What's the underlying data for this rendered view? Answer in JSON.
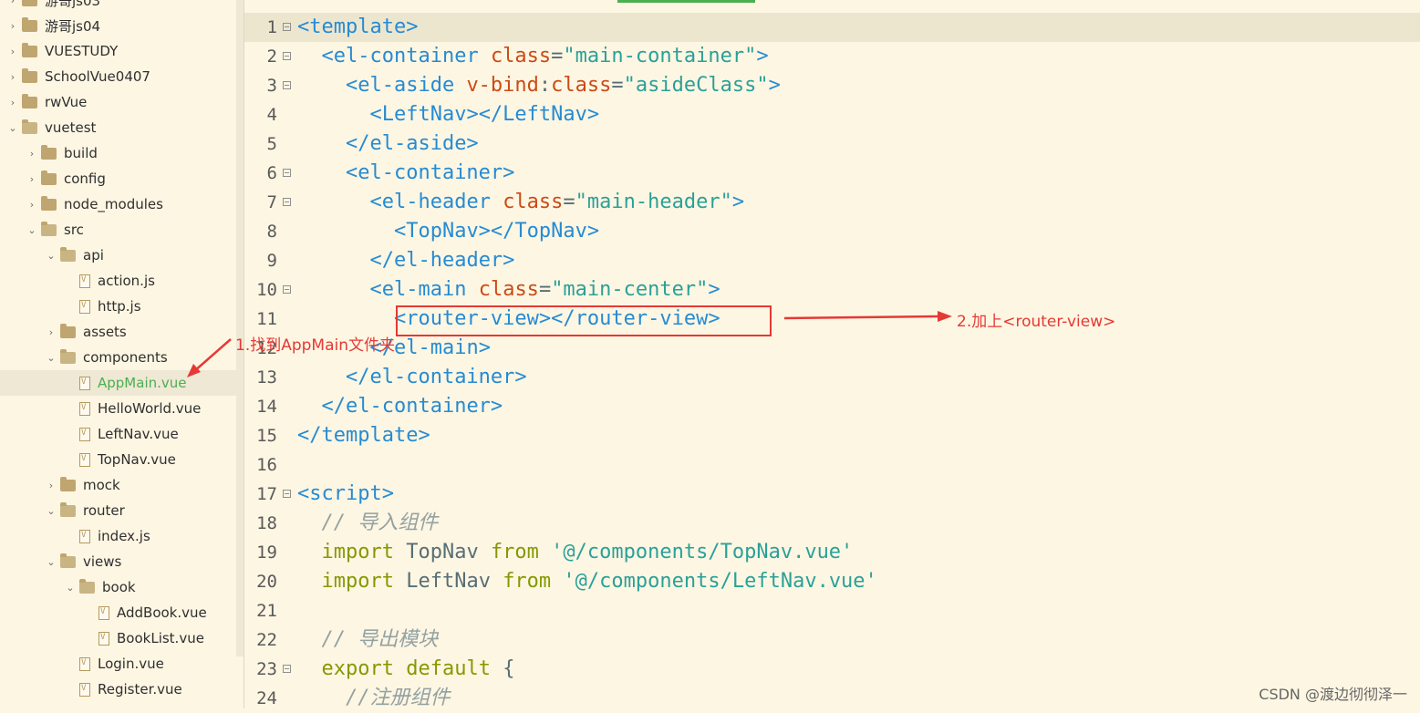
{
  "sidebar": {
    "items": [
      {
        "label": "游哥js03",
        "type": "folder",
        "depth": 0,
        "expanded": false
      },
      {
        "label": "游哥js04",
        "type": "folder",
        "depth": 0,
        "expanded": false
      },
      {
        "label": "VUESTUDY",
        "type": "folder",
        "depth": 0,
        "expanded": false
      },
      {
        "label": "SchoolVue0407",
        "type": "folder",
        "depth": 0,
        "expanded": false
      },
      {
        "label": "rwVue",
        "type": "folder",
        "depth": 0,
        "expanded": false
      },
      {
        "label": "vuetest",
        "type": "folder",
        "depth": 0,
        "expanded": true
      },
      {
        "label": "build",
        "type": "folder",
        "depth": 1,
        "expanded": false
      },
      {
        "label": "config",
        "type": "folder",
        "depth": 1,
        "expanded": false
      },
      {
        "label": "node_modules",
        "type": "folder",
        "depth": 1,
        "expanded": false
      },
      {
        "label": "src",
        "type": "folder",
        "depth": 1,
        "expanded": true
      },
      {
        "label": "api",
        "type": "folder",
        "depth": 2,
        "expanded": true
      },
      {
        "label": "action.js",
        "type": "file",
        "depth": 3
      },
      {
        "label": "http.js",
        "type": "file",
        "depth": 3
      },
      {
        "label": "assets",
        "type": "folder",
        "depth": 2,
        "expanded": false
      },
      {
        "label": "components",
        "type": "folder",
        "depth": 2,
        "expanded": true
      },
      {
        "label": "AppMain.vue",
        "type": "file",
        "depth": 3,
        "selected": true
      },
      {
        "label": "HelloWorld.vue",
        "type": "file",
        "depth": 3
      },
      {
        "label": "LeftNav.vue",
        "type": "file",
        "depth": 3
      },
      {
        "label": "TopNav.vue",
        "type": "file",
        "depth": 3
      },
      {
        "label": "mock",
        "type": "folder",
        "depth": 2,
        "expanded": false
      },
      {
        "label": "router",
        "type": "folder",
        "depth": 2,
        "expanded": true
      },
      {
        "label": "index.js",
        "type": "file",
        "depth": 3
      },
      {
        "label": "views",
        "type": "folder",
        "depth": 2,
        "expanded": true
      },
      {
        "label": "book",
        "type": "folder",
        "depth": 3,
        "expanded": true
      },
      {
        "label": "AddBook.vue",
        "type": "file",
        "depth": 4
      },
      {
        "label": "BookList.vue",
        "type": "file",
        "depth": 4
      },
      {
        "label": "Login.vue",
        "type": "file",
        "depth": 3
      },
      {
        "label": "Register.vue",
        "type": "file",
        "depth": 3
      }
    ]
  },
  "editor": {
    "current_line": 1,
    "lines": [
      {
        "n": "1",
        "fold": true,
        "tokens": [
          [
            "tag",
            "<template>"
          ]
        ]
      },
      {
        "n": "2",
        "fold": true,
        "tokens": [
          [
            "pun",
            "  "
          ],
          [
            "tag",
            "<el-container "
          ],
          [
            "attr",
            "class"
          ],
          [
            "pun",
            "="
          ],
          [
            "str",
            "\"main-container\""
          ],
          [
            "tag",
            ">"
          ]
        ]
      },
      {
        "n": "3",
        "fold": true,
        "tokens": [
          [
            "pun",
            "    "
          ],
          [
            "tag",
            "<el-aside "
          ],
          [
            "attr",
            "v-bind"
          ],
          [
            "pun",
            ":"
          ],
          [
            "attr",
            "class"
          ],
          [
            "pun",
            "="
          ],
          [
            "str",
            "\"asideClass\""
          ],
          [
            "tag",
            ">"
          ]
        ]
      },
      {
        "n": "4",
        "fold": false,
        "tokens": [
          [
            "pun",
            "      "
          ],
          [
            "tag",
            "<LeftNav></LeftNav>"
          ]
        ]
      },
      {
        "n": "5",
        "fold": false,
        "tokens": [
          [
            "pun",
            "    "
          ],
          [
            "tag",
            "</el-aside>"
          ]
        ]
      },
      {
        "n": "6",
        "fold": true,
        "tokens": [
          [
            "pun",
            "    "
          ],
          [
            "tag",
            "<el-container>"
          ]
        ]
      },
      {
        "n": "7",
        "fold": true,
        "tokens": [
          [
            "pun",
            "      "
          ],
          [
            "tag",
            "<el-header "
          ],
          [
            "attr",
            "class"
          ],
          [
            "pun",
            "="
          ],
          [
            "str",
            "\"main-header\""
          ],
          [
            "tag",
            ">"
          ]
        ]
      },
      {
        "n": "8",
        "fold": false,
        "tokens": [
          [
            "pun",
            "        "
          ],
          [
            "tag",
            "<TopNav></TopNav>"
          ]
        ]
      },
      {
        "n": "9",
        "fold": false,
        "tokens": [
          [
            "pun",
            "      "
          ],
          [
            "tag",
            "</el-header>"
          ]
        ]
      },
      {
        "n": "10",
        "fold": true,
        "tokens": [
          [
            "pun",
            "      "
          ],
          [
            "tag",
            "<el-main "
          ],
          [
            "attr",
            "class"
          ],
          [
            "pun",
            "="
          ],
          [
            "str",
            "\"main-center\""
          ],
          [
            "tag",
            ">"
          ]
        ]
      },
      {
        "n": "11",
        "fold": false,
        "tokens": [
          [
            "pun",
            "        "
          ],
          [
            "tag",
            "<router-view></router-view>"
          ]
        ]
      },
      {
        "n": "12",
        "fold": false,
        "tokens": [
          [
            "pun",
            "      "
          ],
          [
            "tag",
            "</el-main>"
          ]
        ]
      },
      {
        "n": "13",
        "fold": false,
        "tokens": [
          [
            "pun",
            "    "
          ],
          [
            "tag",
            "</el-container>"
          ]
        ]
      },
      {
        "n": "14",
        "fold": false,
        "tokens": [
          [
            "pun",
            "  "
          ],
          [
            "tag",
            "</el-container>"
          ]
        ]
      },
      {
        "n": "15",
        "fold": false,
        "tokens": [
          [
            "tag",
            "</template>"
          ]
        ]
      },
      {
        "n": "16",
        "fold": false,
        "tokens": []
      },
      {
        "n": "17",
        "fold": true,
        "tokens": [
          [
            "tag",
            "<script>"
          ]
        ]
      },
      {
        "n": "18",
        "fold": false,
        "tokens": [
          [
            "pun",
            "  "
          ],
          [
            "cmt",
            "// 导入组件"
          ]
        ]
      },
      {
        "n": "19",
        "fold": false,
        "tokens": [
          [
            "pun",
            "  "
          ],
          [
            "kw",
            "import "
          ],
          [
            "plain",
            "TopNav "
          ],
          [
            "kw",
            "from "
          ],
          [
            "str",
            "'@/components/TopNav.vue'"
          ]
        ]
      },
      {
        "n": "20",
        "fold": false,
        "tokens": [
          [
            "pun",
            "  "
          ],
          [
            "kw",
            "import "
          ],
          [
            "plain",
            "LeftNav "
          ],
          [
            "kw",
            "from "
          ],
          [
            "str",
            "'@/components/LeftNav.vue'"
          ]
        ]
      },
      {
        "n": "21",
        "fold": false,
        "tokens": []
      },
      {
        "n": "22",
        "fold": false,
        "tokens": [
          [
            "pun",
            "  "
          ],
          [
            "cmt",
            "// 导出模块"
          ]
        ]
      },
      {
        "n": "23",
        "fold": true,
        "tokens": [
          [
            "pun",
            "  "
          ],
          [
            "kw",
            "export "
          ],
          [
            "kw",
            "default "
          ],
          [
            "plain",
            "{"
          ]
        ]
      },
      {
        "n": "24",
        "fold": false,
        "tokens": [
          [
            "pun",
            "    "
          ],
          [
            "cmt",
            "//注册组件"
          ]
        ]
      }
    ]
  },
  "annotations": {
    "step1": "1.找到AppMain文件夹",
    "step2": "2.加上<router-view>",
    "color": "#e53935"
  },
  "watermark": "CSDN @渡边彻彻泽一"
}
